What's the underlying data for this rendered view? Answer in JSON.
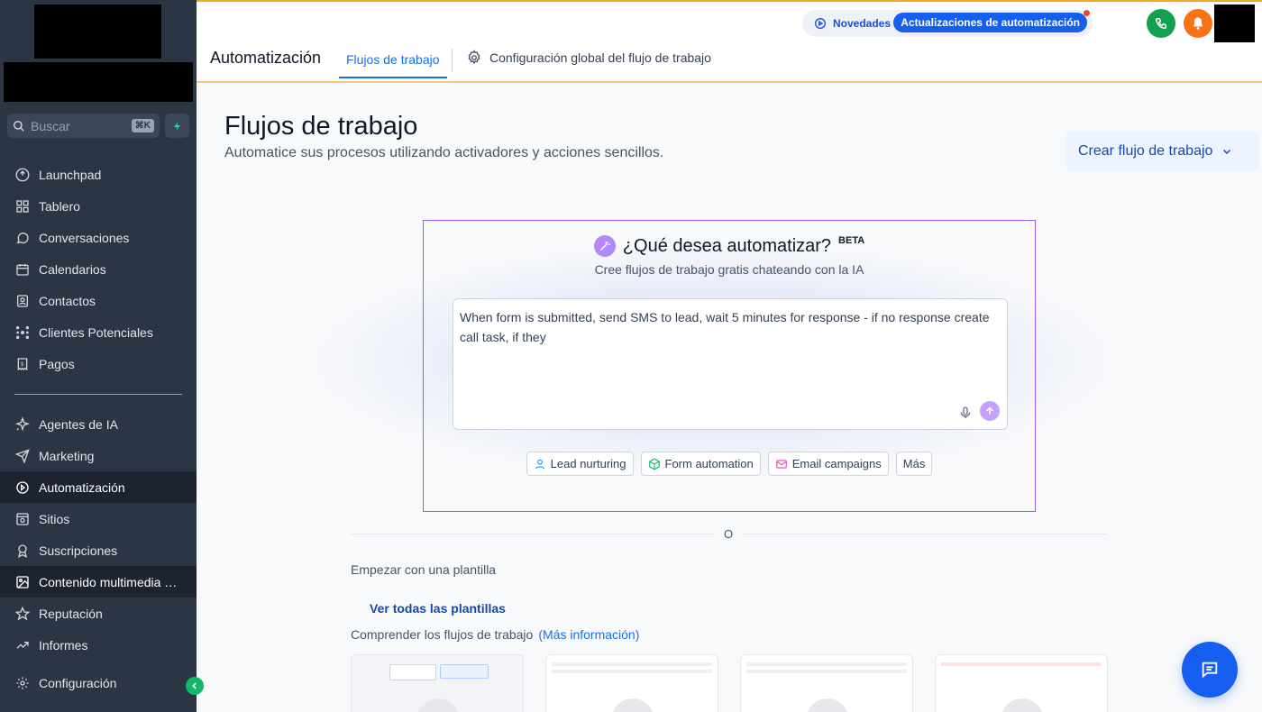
{
  "sidebar": {
    "search_placeholder": "Buscar",
    "search_shortcut": "⌘K",
    "items_top": [
      {
        "label": "Launchpad",
        "icon": "launchpad-icon"
      },
      {
        "label": "Tablero",
        "icon": "dashboard-icon"
      },
      {
        "label": "Conversaciones",
        "icon": "chat-bubble-icon"
      },
      {
        "label": "Calendarios",
        "icon": "calendar-icon"
      },
      {
        "label": "Contactos",
        "icon": "contacts-icon"
      },
      {
        "label": "Clientes Potenciales",
        "icon": "network-icon"
      },
      {
        "label": "Pagos",
        "icon": "receipt-icon"
      }
    ],
    "items_bottom": [
      {
        "label": "Agentes de IA",
        "icon": "sparkles-icon"
      },
      {
        "label": "Marketing",
        "icon": "send-icon"
      },
      {
        "label": "Automatización",
        "icon": "automation-icon"
      },
      {
        "label": "Sitios",
        "icon": "sites-icon"
      },
      {
        "label": "Suscripciones",
        "icon": "award-icon"
      },
      {
        "label": "Contenido multimedia U...",
        "icon": "image-icon"
      },
      {
        "label": "Reputación",
        "icon": "star-icon"
      },
      {
        "label": "Informes",
        "icon": "trend-icon"
      }
    ],
    "settings_label": "Configuración"
  },
  "topbar": {
    "novedades_label": "Novedades",
    "updates_label": "Actualizaciones de automatización",
    "app_title": "Automatización",
    "tab_workflows": "Flujos de trabajo",
    "tab_global_config": "Configuración global del flujo de trabajo"
  },
  "main": {
    "title": "Flujos de trabajo",
    "subtitle": "Automatice sus procesos utilizando activadores y acciones sencillos.",
    "create_button": "Crear flujo de trabajo",
    "ai": {
      "title": "¿Qué desea automatizar?",
      "badge": "BETA",
      "subtitle": "Cree flujos de trabajo gratis chateando con la IA",
      "prompt_value": "When form is submitted, send SMS to lead, wait 5 minutes for response - if no response create call task, if they",
      "chips": [
        "Lead nurturing",
        "Form automation",
        "Email campaigns",
        "Más"
      ]
    },
    "or_text": "O",
    "start_template": "Empezar con una plantilla",
    "see_all_templates": "Ver todas las plantillas",
    "understand_workflows": "Comprender los flujos de trabajo",
    "more_info": "(Más información)"
  },
  "colors": {
    "sidebar_bg": "#2b3544",
    "accent": "#155eef",
    "ai_border": "#9b59f6",
    "top_border": "#f5a524"
  }
}
